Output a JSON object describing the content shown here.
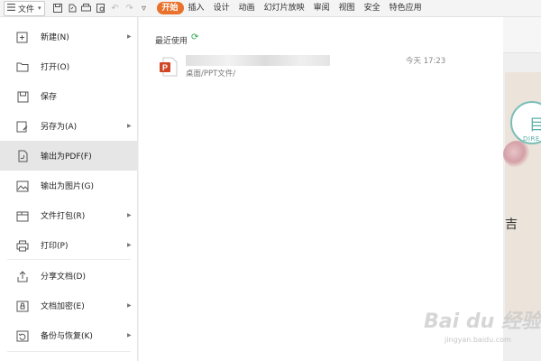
{
  "toolbar": {
    "file_label": "文件",
    "tabs": [
      "开始",
      "插入",
      "设计",
      "动画",
      "幻灯片放映",
      "审阅",
      "视图",
      "安全",
      "特色应用"
    ]
  },
  "file_menu": {
    "items": [
      {
        "label": "新建(N)",
        "icon": "new-doc-icon",
        "submenu": true
      },
      {
        "label": "打开(O)",
        "icon": "folder-open-icon",
        "submenu": false
      },
      {
        "label": "保存",
        "icon": "save-icon",
        "submenu": false
      },
      {
        "label": "另存为(A)",
        "icon": "save-as-icon",
        "submenu": true
      },
      {
        "label": "输出为PDF(F)",
        "icon": "pdf-export-icon",
        "submenu": false,
        "selected": true
      },
      {
        "label": "输出为图片(G)",
        "icon": "image-export-icon",
        "submenu": false
      },
      {
        "label": "文件打包(R)",
        "icon": "package-icon",
        "submenu": true
      },
      {
        "label": "打印(P)",
        "icon": "print-icon",
        "submenu": true
      },
      {
        "label": "分享文档(D)",
        "icon": "share-icon",
        "submenu": false
      },
      {
        "label": "文档加密(E)",
        "icon": "lock-icon",
        "submenu": true
      },
      {
        "label": "备份与恢复(K)",
        "icon": "backup-icon",
        "submenu": true
      }
    ]
  },
  "recent": {
    "title": "最近使用",
    "files": [
      {
        "path": "桌面/PPT文件/",
        "time": "今天 17:23"
      }
    ]
  },
  "slide": {
    "circle_char": "目",
    "circle_text": "DIRE",
    "side_char": "吉"
  },
  "watermark": {
    "text": "Bai du 经验",
    "url": "jingyan.baidu.com"
  },
  "colors": {
    "accent": "#e9712b",
    "menu_selected": "#e6e6e6",
    "refresh": "#2aa84a",
    "ppt_red": "#d24625"
  }
}
